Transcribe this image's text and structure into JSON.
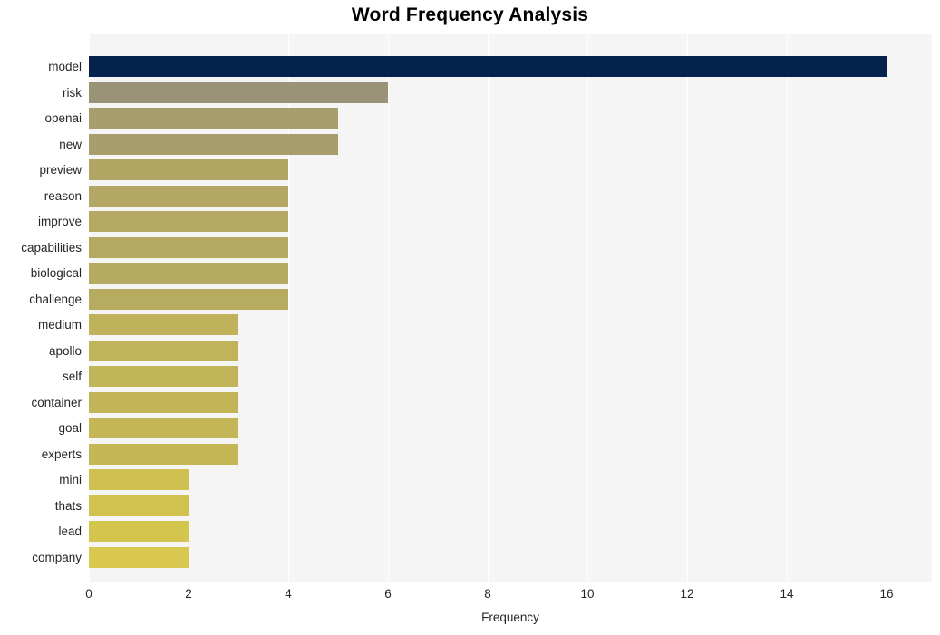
{
  "chart_data": {
    "type": "bar",
    "orientation": "horizontal",
    "title": "Word Frequency Analysis",
    "xlabel": "Frequency",
    "ylabel": "",
    "categories": [
      "model",
      "risk",
      "openai",
      "new",
      "preview",
      "reason",
      "improve",
      "capabilities",
      "biological",
      "challenge",
      "medium",
      "apollo",
      "self",
      "container",
      "goal",
      "experts",
      "mini",
      "thats",
      "lead",
      "company"
    ],
    "values": [
      16,
      6,
      5,
      5,
      4,
      4,
      4,
      4,
      4,
      4,
      3,
      3,
      3,
      3,
      3,
      3,
      2,
      2,
      2,
      2
    ],
    "bar_colors": [
      "#03224c",
      "#9b9377",
      "#a89d6c",
      "#a99e6b",
      "#b2a664",
      "#b3a763",
      "#b4a862",
      "#b5a961",
      "#b6aa60",
      "#b7ab5f",
      "#c0b25a",
      "#c1b359",
      "#c2b458",
      "#c3b557",
      "#c4b656",
      "#c5b755",
      "#cfc051",
      "#d1c250",
      "#d4c54f",
      "#d9c84f"
    ],
    "xticks": [
      0,
      2,
      4,
      6,
      8,
      10,
      12,
      14,
      16
    ],
    "xtick_labels": [
      "0",
      "2",
      "4",
      "6",
      "8",
      "10",
      "12",
      "14",
      "16"
    ],
    "xlim": [
      0,
      16.9
    ],
    "grid": "vertical-only",
    "legend": "none",
    "plot_background": "#f6f5f5",
    "gridline_color": "#ffffff",
    "figure_background": "#ffffff",
    "title_color": "#000000",
    "tick_label_color": "#262626"
  }
}
